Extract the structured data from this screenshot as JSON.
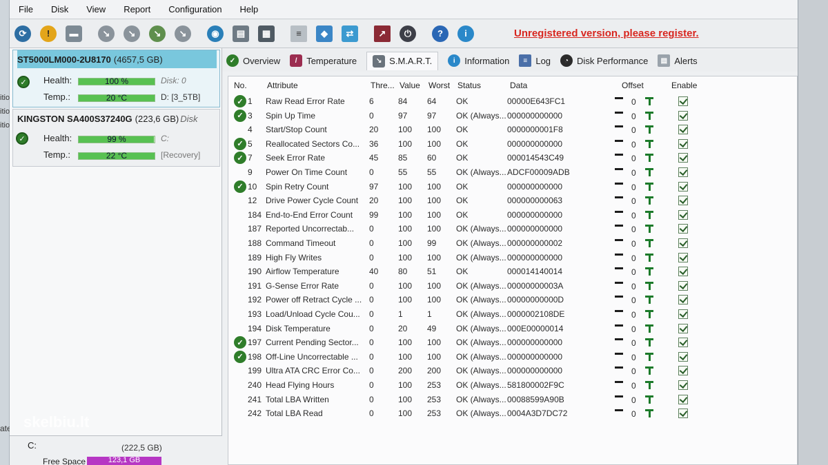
{
  "menu": [
    "File",
    "Disk",
    "View",
    "Report",
    "Configuration",
    "Help"
  ],
  "left_strip_text": [
    "itio",
    "itio",
    "itio",
    "ated"
  ],
  "unregistered": "Unregistered version, please register.",
  "disks": [
    {
      "name": "ST5000LM000-2U8170",
      "capacity": "(4657,5 GB)",
      "tail": "",
      "health_label": "Health:",
      "health": "100 %",
      "health_pct": 100,
      "disk_info": "Disk: 0",
      "temp_label": "Temp.:",
      "temp": "20 °C",
      "volume_info": "D: [3_5TB]"
    },
    {
      "name": "KINGSTON SA400S37240G",
      "capacity": "(223,6 GB)",
      "tail": "Disk",
      "health_label": "Health:",
      "health": "99 %",
      "health_pct": 99,
      "disk_info": "C:",
      "temp_label": "Temp.:",
      "temp": "22 °C",
      "volume_info": "[Recovery]"
    }
  ],
  "volume": {
    "name": "C:",
    "size": "(222,5 GB)",
    "free_label": "Free Space",
    "free_value": "123,1 GB"
  },
  "tabs": [
    "Overview",
    "Temperature",
    "S.M.A.R.T.",
    "Information",
    "Log",
    "Disk Performance",
    "Alerts"
  ],
  "smart": {
    "headers": {
      "no": "No.",
      "attribute": "Attribute",
      "threshold": "Thre...",
      "value": "Value",
      "worst": "Worst",
      "status": "Status",
      "data": "Data",
      "offset": "Offset",
      "enable": "Enable"
    },
    "rows": [
      {
        "ok": true,
        "no": "1",
        "attribute": "Raw Read Error Rate",
        "threshold": "6",
        "value": "84",
        "worst": "64",
        "status": "OK",
        "data": "00000E643FC1",
        "offset": "0"
      },
      {
        "ok": true,
        "no": "3",
        "attribute": "Spin Up Time",
        "threshold": "0",
        "value": "97",
        "worst": "97",
        "status": "OK (Always...",
        "data": "000000000000",
        "offset": "0"
      },
      {
        "ok": false,
        "no": "4",
        "attribute": "Start/Stop Count",
        "threshold": "20",
        "value": "100",
        "worst": "100",
        "status": "OK",
        "data": "0000000001F8",
        "offset": "0"
      },
      {
        "ok": true,
        "no": "5",
        "attribute": "Reallocated Sectors Co...",
        "threshold": "36",
        "value": "100",
        "worst": "100",
        "status": "OK",
        "data": "000000000000",
        "offset": "0"
      },
      {
        "ok": true,
        "no": "7",
        "attribute": "Seek Error Rate",
        "threshold": "45",
        "value": "85",
        "worst": "60",
        "status": "OK",
        "data": "000014543C49",
        "offset": "0"
      },
      {
        "ok": false,
        "no": "9",
        "attribute": "Power On Time Count",
        "threshold": "0",
        "value": "55",
        "worst": "55",
        "status": "OK (Always...",
        "data": "ADCF00009ADB",
        "offset": "0"
      },
      {
        "ok": true,
        "no": "10",
        "attribute": "Spin Retry Count",
        "threshold": "97",
        "value": "100",
        "worst": "100",
        "status": "OK",
        "data": "000000000000",
        "offset": "0"
      },
      {
        "ok": false,
        "no": "12",
        "attribute": "Drive Power Cycle Count",
        "threshold": "20",
        "value": "100",
        "worst": "100",
        "status": "OK",
        "data": "000000000063",
        "offset": "0"
      },
      {
        "ok": false,
        "no": "184",
        "attribute": "End-to-End Error Count",
        "threshold": "99",
        "value": "100",
        "worst": "100",
        "status": "OK",
        "data": "000000000000",
        "offset": "0"
      },
      {
        "ok": false,
        "no": "187",
        "attribute": "Reported Uncorrectab...",
        "threshold": "0",
        "value": "100",
        "worst": "100",
        "status": "OK (Always...",
        "data": "000000000000",
        "offset": "0"
      },
      {
        "ok": false,
        "no": "188",
        "attribute": "Command Timeout",
        "threshold": "0",
        "value": "100",
        "worst": "99",
        "status": "OK (Always...",
        "data": "000000000002",
        "offset": "0"
      },
      {
        "ok": false,
        "no": "189",
        "attribute": "High Fly Writes",
        "threshold": "0",
        "value": "100",
        "worst": "100",
        "status": "OK (Always...",
        "data": "000000000000",
        "offset": "0"
      },
      {
        "ok": false,
        "no": "190",
        "attribute": "Airflow Temperature",
        "threshold": "40",
        "value": "80",
        "worst": "51",
        "status": "OK",
        "data": "000014140014",
        "offset": "0"
      },
      {
        "ok": false,
        "no": "191",
        "attribute": "G-Sense Error Rate",
        "threshold": "0",
        "value": "100",
        "worst": "100",
        "status": "OK (Always...",
        "data": "00000000003A",
        "offset": "0"
      },
      {
        "ok": false,
        "no": "192",
        "attribute": "Power off Retract Cycle ...",
        "threshold": "0",
        "value": "100",
        "worst": "100",
        "status": "OK (Always...",
        "data": "00000000000D",
        "offset": "0"
      },
      {
        "ok": false,
        "no": "193",
        "attribute": "Load/Unload Cycle Cou...",
        "threshold": "0",
        "value": "1",
        "worst": "1",
        "status": "OK (Always...",
        "data": "0000002108DE",
        "offset": "0"
      },
      {
        "ok": false,
        "no": "194",
        "attribute": "Disk Temperature",
        "threshold": "0",
        "value": "20",
        "worst": "49",
        "status": "OK (Always...",
        "data": "000E00000014",
        "offset": "0"
      },
      {
        "ok": true,
        "no": "197",
        "attribute": "Current Pending Sector...",
        "threshold": "0",
        "value": "100",
        "worst": "100",
        "status": "OK (Always...",
        "data": "000000000000",
        "offset": "0"
      },
      {
        "ok": true,
        "no": "198",
        "attribute": "Off-Line Uncorrectable ...",
        "threshold": "0",
        "value": "100",
        "worst": "100",
        "status": "OK (Always...",
        "data": "000000000000",
        "offset": "0"
      },
      {
        "ok": false,
        "no": "199",
        "attribute": "Ultra ATA CRC Error Co...",
        "threshold": "0",
        "value": "200",
        "worst": "200",
        "status": "OK (Always...",
        "data": "000000000000",
        "offset": "0"
      },
      {
        "ok": false,
        "no": "240",
        "attribute": "Head Flying Hours",
        "threshold": "0",
        "value": "100",
        "worst": "253",
        "status": "OK (Always...",
        "data": "581800002F9C",
        "offset": "0"
      },
      {
        "ok": false,
        "no": "241",
        "attribute": "Total LBA Written",
        "threshold": "0",
        "value": "100",
        "worst": "253",
        "status": "OK (Always...",
        "data": "00088599A90B",
        "offset": "0"
      },
      {
        "ok": false,
        "no": "242",
        "attribute": "Total LBA Read",
        "threshold": "0",
        "value": "100",
        "worst": "253",
        "status": "OK (Always...",
        "data": "0004A3D7DC72",
        "offset": "0"
      }
    ]
  },
  "watermark": "skelbiu.lt"
}
